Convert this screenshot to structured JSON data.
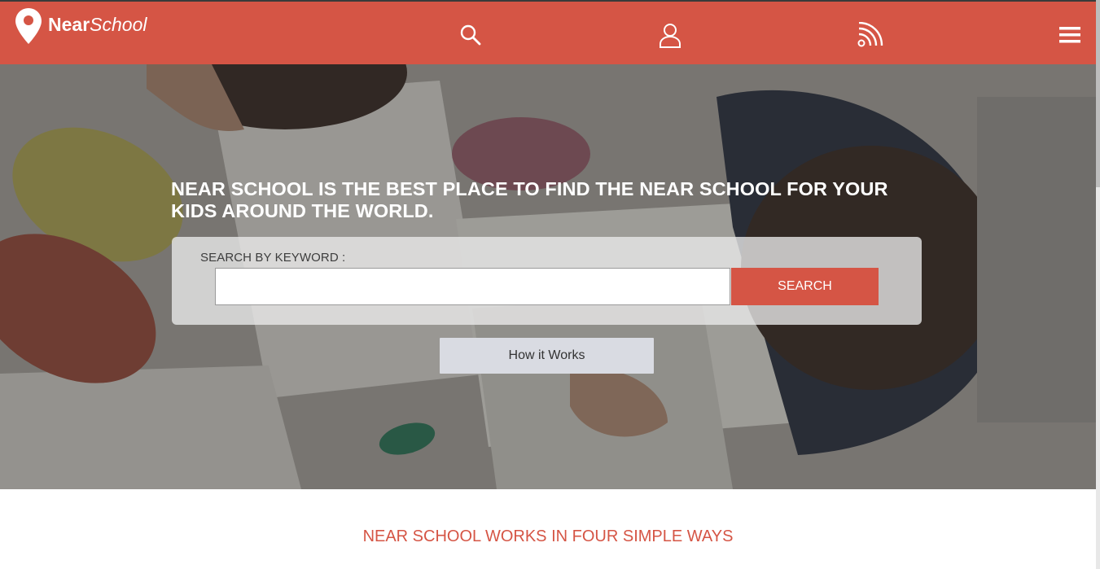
{
  "header": {
    "logo_bold": "Near",
    "logo_italic": "School",
    "icons": [
      "search-icon",
      "user-icon",
      "rss-icon",
      "hamburger-menu-icon"
    ]
  },
  "hero": {
    "title": "NEAR SCHOOL IS THE BEST PLACE TO FIND THE NEAR SCHOOL FOR YOUR KIDS AROUND THE WORLD.",
    "search_label": "SEARCH BY KEYWORD :",
    "search_value": "",
    "search_placeholder": "",
    "search_button": "SEARCH",
    "how_button": "How it Works"
  },
  "section": {
    "title": "NEAR SCHOOL WORKS IN FOUR SIMPLE WAYS"
  },
  "colors": {
    "brand": "#d55545",
    "header_bg": "#d55545",
    "button_light": "#d9dbe2"
  }
}
